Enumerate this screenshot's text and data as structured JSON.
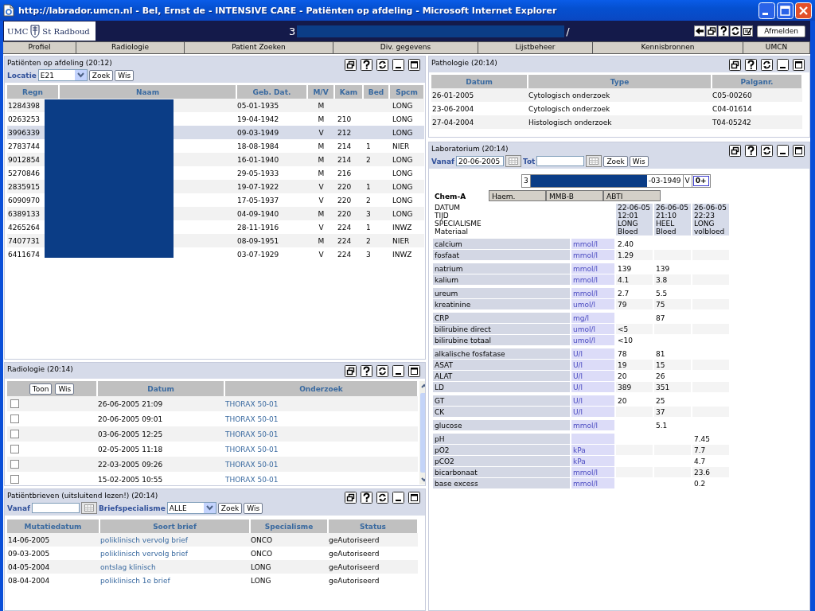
{
  "window": {
    "title": "http://labrador.umcn.nl - Bel, Ernst de - INTENSIVE CARE - Patiënten op afdeling - Microsoft Internet Explorer"
  },
  "header": {
    "logo_left": "UMC",
    "logo_right": "St Radboud",
    "patient_start": "3",
    "patient_end": "/",
    "logout": "Afmelden"
  },
  "nav": [
    "Profiel",
    "Radiologie",
    "Patient Zoeken",
    "Div. gegevens",
    "Lijstbeheer",
    "Kennisbronnen",
    "UMCN"
  ],
  "patients": {
    "title": "Patiënten op afdeling (20:12)",
    "location_label": "Locatie",
    "location": "E21",
    "buttons": [
      "Zoek",
      "Wis"
    ],
    "columns": [
      "Regn",
      "Naam",
      "Geb. Dat.",
      "M/V",
      "Kam",
      "Bed",
      "Spcm"
    ],
    "rows": [
      {
        "regnr": "1284398",
        "born": "05-01-1935",
        "sex": "M",
        "spec": "LONG",
        "selected": false
      },
      {
        "regnr": "0263253",
        "born": "19-04-1942",
        "sex": "M",
        "room": "210",
        "spec": "LONG",
        "selected": false
      },
      {
        "regnr": "3996339",
        "born": "09-03-1949",
        "sex": "V",
        "room": "212",
        "spec": "LONG",
        "selected": true
      },
      {
        "regnr": "2783744",
        "born": "18-08-1984",
        "sex": "M",
        "room": "214",
        "bed": "1",
        "spec": "NIER",
        "selected": false
      },
      {
        "regnr": "9012854",
        "born": "16-01-1940",
        "sex": "M",
        "room": "214",
        "bed": "2",
        "spec": "LONG",
        "selected": false
      },
      {
        "regnr": "5270846",
        "born": "29-05-1933",
        "sex": "M",
        "room": "216",
        "spec": "LONG",
        "selected": false
      },
      {
        "regnr": "2835915",
        "born": "19-07-1922",
        "sex": "V",
        "room": "220",
        "bed": "1",
        "spec": "LONG",
        "selected": false
      },
      {
        "regnr": "6090970",
        "born": "17-05-1937",
        "sex": "V",
        "room": "220",
        "bed": "2",
        "spec": "LONG",
        "selected": false
      },
      {
        "regnr": "6389133",
        "born": "04-09-1940",
        "sex": "M",
        "room": "220",
        "bed": "3",
        "spec": "LONG",
        "selected": false
      },
      {
        "regnr": "4265264",
        "born": "28-11-1916",
        "sex": "V",
        "room": "224",
        "bed": "1",
        "spec": "INWZ",
        "selected": false
      },
      {
        "regnr": "7407731",
        "born": "08-09-1951",
        "sex": "M",
        "room": "224",
        "bed": "2",
        "spec": "NIER",
        "selected": false
      },
      {
        "regnr": "6411674",
        "born": "03-07-1929",
        "sex": "V",
        "room": "224",
        "bed": "3",
        "spec": "INWZ",
        "selected": false
      }
    ]
  },
  "radiology": {
    "title": "Radiologie (20:14)",
    "buttons": [
      "Toon",
      "Wis"
    ],
    "columns": [
      "Datum",
      "Onderzoek"
    ],
    "rows": [
      {
        "checked": false,
        "date": "26-06-2005 21:09",
        "exam": "THORAX 50-01"
      },
      {
        "checked": false,
        "date": "20-06-2005 09:01",
        "exam": "THORAX 50-01"
      },
      {
        "checked": false,
        "date": "03-06-2005 12:25",
        "exam": "THORAX 50-01"
      },
      {
        "checked": false,
        "date": "02-05-2005 11:18",
        "exam": "THORAX 50-01"
      },
      {
        "checked": false,
        "date": "22-03-2005 09:26",
        "exam": "THORAX 50-01"
      },
      {
        "checked": false,
        "date": "15-02-2005 10:55",
        "exam": "THORAX 50-01"
      }
    ]
  },
  "letters": {
    "title": "Patiëntbrieven (uitsluitend lezen!) (20:14)",
    "from_label": "Vanaf",
    "specialism_label": "Briefspecialisme",
    "specialism": "ALLE",
    "buttons": [
      "Zoek",
      "Wis"
    ],
    "columns": [
      "Mutatiedatum",
      "Soort brief",
      "Specialisme",
      "Status"
    ],
    "rows": [
      {
        "date": "14-06-2005",
        "type": "poliklinisch vervolg brief",
        "spec": "ONCO",
        "status": "geAutoriseerd"
      },
      {
        "date": "09-03-2005",
        "type": "poliklinisch vervolg brief",
        "spec": "ONCO",
        "status": "geAutoriseerd"
      },
      {
        "date": "04-05-2004",
        "type": "ontslag klinisch",
        "spec": "LONG",
        "status": "geAutoriseerd"
      },
      {
        "date": "08-04-2004",
        "type": "poliklinisch 1e brief",
        "spec": "LONG",
        "status": "geAutoriseerd"
      }
    ]
  },
  "pathology": {
    "title": "Pathologie (20:14)",
    "columns": [
      "Datum",
      "Type",
      "Palganr."
    ],
    "rows": [
      {
        "date": "26-01-2005",
        "type": "Cytologisch onderzoek",
        "code": "C05-00260"
      },
      {
        "date": "23-06-2004",
        "type": "Cytologisch onderzoek",
        "code": "C04-01614"
      },
      {
        "date": "27-04-2004",
        "type": "Histologisch onderzoek",
        "code": "T04-05242"
      }
    ]
  },
  "lab": {
    "title": "Laboratorium (20:14)",
    "from_label": "Vanaf",
    "from": "20-06-2005",
    "to_label": "Tot",
    "buttons": [
      "Zoek",
      "Wis"
    ],
    "patient": {
      "start": "3",
      "born_end": "-03-1949",
      "sex": "V",
      "blood": "0+"
    },
    "tabs": [
      {
        "label": "Chem-A",
        "selected": true
      },
      {
        "label": "Haem.",
        "selected": false
      },
      {
        "label": "MMB-B",
        "selected": false
      },
      {
        "label": "ABTI",
        "selected": false
      }
    ],
    "header_labels": [
      "DATUM",
      "TIJD",
      "SPECIALISME",
      "Materiaal"
    ],
    "samples": [
      {
        "date": "22-06-05",
        "time": "12:01",
        "spec": "LONG",
        "material": "Bloed"
      },
      {
        "date": "26-06-05",
        "time": "21:10",
        "spec": "HEEL",
        "material": "Bloed"
      },
      {
        "date": "26-06-05",
        "time": "22:23",
        "spec": "LONG",
        "material": "volbloed"
      }
    ],
    "groups": [
      [
        {
          "name": "calcium",
          "unit": "mmol/l",
          "v1": "2.40"
        },
        {
          "name": "fosfaat",
          "unit": "mmol/l",
          "v1": "1.29"
        }
      ],
      [
        {
          "name": "natrium",
          "unit": "mmol/l",
          "v1": "139",
          "v2": "139"
        },
        {
          "name": "kalium",
          "unit": "mmol/l",
          "v1": "4.1",
          "v2": "3.8"
        }
      ],
      [
        {
          "name": "ureum",
          "unit": "mmol/l",
          "v1": "2.7",
          "v2": "5.5"
        },
        {
          "name": "kreatinine",
          "unit": "umol/l",
          "v1": "79",
          "v2": "75"
        }
      ],
      [
        {
          "name": "CRP",
          "unit": "mg/l",
          "v2": "87"
        },
        {
          "name": "bilirubine direct",
          "unit": "umol/l",
          "v1": "<5"
        },
        {
          "name": "bilirubine totaal",
          "unit": "umol/l",
          "v1": "<10"
        }
      ],
      [
        {
          "name": "alkalische fosfatase",
          "unit": "U/l",
          "v1": "78",
          "v2": "81"
        },
        {
          "name": "ASAT",
          "unit": "U/l",
          "v1": "19",
          "v2": "15"
        },
        {
          "name": "ALAT",
          "unit": "U/l",
          "v1": "20",
          "v2": "26"
        },
        {
          "name": "LD",
          "unit": "U/l",
          "v1": "389",
          "v2": "351"
        }
      ],
      [
        {
          "name": "GT",
          "unit": "U/l",
          "v1": "20",
          "v2": "25"
        },
        {
          "name": "CK",
          "unit": "U/l",
          "v2": "37"
        }
      ],
      [
        {
          "name": "glucose",
          "unit": "mmol/l",
          "v2": "5.1"
        }
      ],
      [
        {
          "name": "pH",
          "v3": "7.45"
        },
        {
          "name": "pO2",
          "unit": "kPa",
          "v3": "7.7"
        },
        {
          "name": "pCO2",
          "unit": "kPa",
          "v3": "4.7"
        },
        {
          "name": "bicarbonaat",
          "unit": "mmol/l",
          "v3": "23.6"
        },
        {
          "name": "base excess",
          "unit": "mmol/l",
          "v3": "0.2"
        }
      ]
    ]
  }
}
